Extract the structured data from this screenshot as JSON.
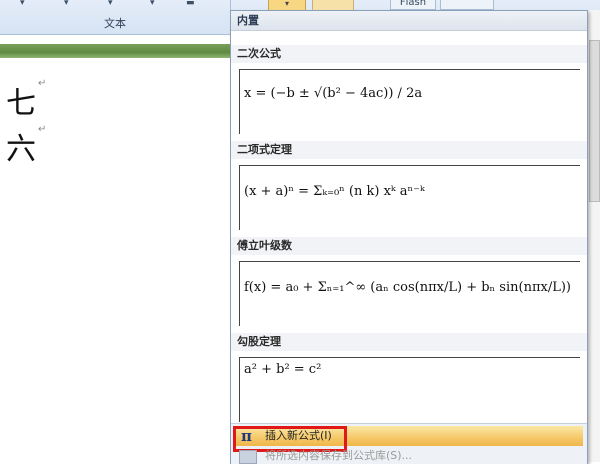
{
  "ribbon": {
    "group_label": "文本",
    "flash_label": "Flash"
  },
  "document": {
    "lines": [
      "七",
      "六"
    ],
    "paragraph_mark": "↵"
  },
  "gallery": {
    "header": "内置",
    "categories": [
      {
        "name": "二次公式",
        "formula": "x = (−b ± √(b² − 4ac)) / 2a"
      },
      {
        "name": "二项式定理",
        "formula": "(x + a)ⁿ = Σₖ₌₀ⁿ (n k) xᵏ aⁿ⁻ᵏ"
      },
      {
        "name": "傅立叶级数",
        "formula": "f(x) = a₀ + Σₙ₌₁^∞ (aₙ cos(nπx/L) + bₙ sin(nπx/L))"
      },
      {
        "name": "勾股定理",
        "formula": "a² + b² = c²"
      }
    ],
    "insert_button": {
      "icon": "pi-icon",
      "label": "插入新公式(I)"
    },
    "save_item": {
      "label": "将所选内容保存到公式库(S)..."
    }
  }
}
